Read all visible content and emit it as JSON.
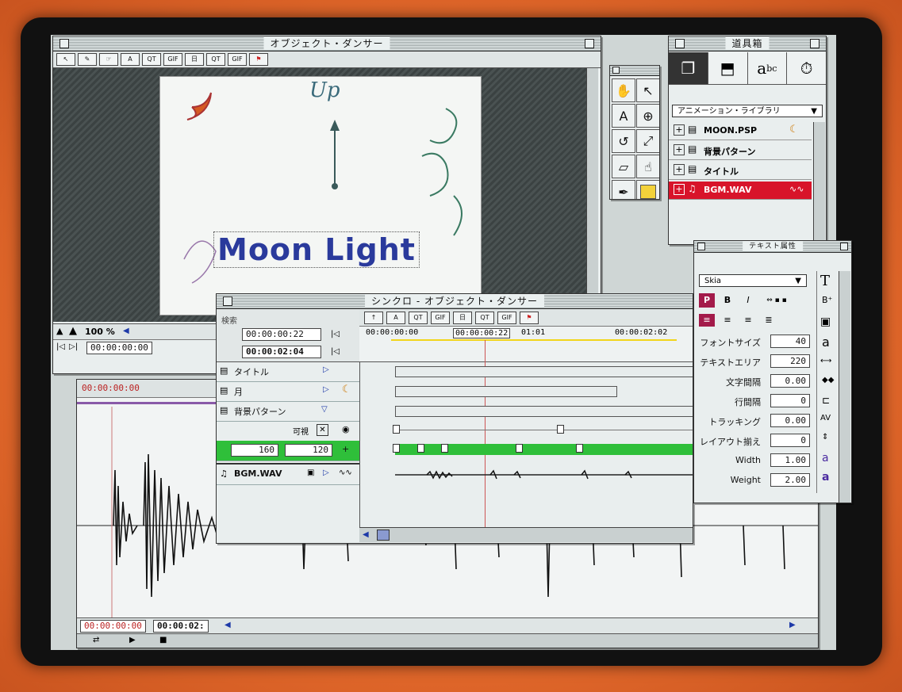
{
  "main_window": {
    "title": "オブジェクト・ダンサー",
    "toolbar": [
      "QT",
      "GIF",
      "日",
      "QT",
      "GIF"
    ],
    "canvas_text": "Moon Light",
    "canvas_handwriting": "Up",
    "zoom": "100 %",
    "timecode": "00:00:00:00"
  },
  "wave_window": {
    "timecode_top": "00:00:00:00",
    "timecode_start": "00:00:00:00",
    "timecode_end": "00:00:02:"
  },
  "sync_window": {
    "title": "シンクロ - オブジェクト・ダンサー",
    "search_label": "検索",
    "time_current": "00:00:00:22",
    "time_total": "00:00:02:04",
    "ruler": [
      "00:00:00:00",
      "00:00:00:22",
      "01:01",
      "00:00:02:02"
    ],
    "tracks": [
      {
        "label": "タイトル"
      },
      {
        "label": "月"
      },
      {
        "label": "背景パターン"
      }
    ],
    "visible_label": "可視",
    "value_a": "160",
    "value_b": "120",
    "audio_track": "BGM.WAV"
  },
  "toolbox": {
    "title": "道具箱",
    "library_select": "アニメーション・ライブラリ",
    "items": [
      {
        "name": "MOON.PSP"
      },
      {
        "name": "背景パターン"
      },
      {
        "name": "タイトル"
      },
      {
        "name": "BGM.WAV"
      }
    ]
  },
  "tools_palette": {
    "icons": [
      "hand-icon",
      "arrow-icon",
      "text-icon",
      "zoom-icon",
      "rotate-icon",
      "scale-icon",
      "skew-icon",
      "pan-icon",
      "eyedropper-icon",
      "color-swatch"
    ]
  },
  "text_props": {
    "title": "テキスト属性",
    "font": "Skia",
    "styles": [
      "P",
      "B",
      "I"
    ],
    "rows": [
      {
        "label": "フォントサイズ",
        "value": "40"
      },
      {
        "label": "テキストエリア",
        "value": "220"
      },
      {
        "label": "文字間隔",
        "value": "0.00"
      },
      {
        "label": "行間隔",
        "value": "0"
      },
      {
        "label": "トラッキング",
        "value": "0.00"
      },
      {
        "label": "レイアウト揃え",
        "value": "0"
      },
      {
        "label": "Width",
        "value": "1.00"
      },
      {
        "label": "Weight",
        "value": "2.00"
      }
    ]
  },
  "colors": {
    "accent_green": "#2fbf3a",
    "selected_red": "#d8142a",
    "title_blue": "#2a3a9c"
  }
}
